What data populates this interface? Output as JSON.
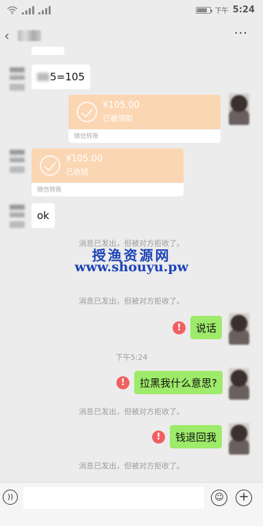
{
  "status_bar": {
    "time_prefix": "下午",
    "time": "5:24"
  },
  "header": {
    "more_label": "···"
  },
  "messages": {
    "m1_text": "5=105",
    "transfer1": {
      "amount": "¥105.00",
      "status": "已被领取",
      "label": "微信转账"
    },
    "transfer2": {
      "amount": "¥105.00",
      "status": "已收钱",
      "label": "微信转账"
    },
    "m2_text": "ok",
    "notice_1": "消息已发出，但被对方拒收了。",
    "notice_2": "消息已发出，但被对方拒收了。",
    "m3_text": "说话",
    "timestamp": "下午5:24",
    "m4_text": "拉黑我什么意思?",
    "notice_3": "消息已发出，但被对方拒收了。",
    "m5_text": "钱退回我",
    "notice_4": "消息已发出，但被对方拒收了。"
  },
  "watermark": {
    "line1": "授渔资源网",
    "line2": "www.shouyu.pw"
  },
  "input_bar": {
    "placeholder": ""
  },
  "colors": {
    "sent_bubble": "#9eea6a",
    "received_bubble": "#ffffff",
    "transfer_bg": "#fbd6b3",
    "error": "#f06060",
    "watermark": "#1d43b8"
  }
}
